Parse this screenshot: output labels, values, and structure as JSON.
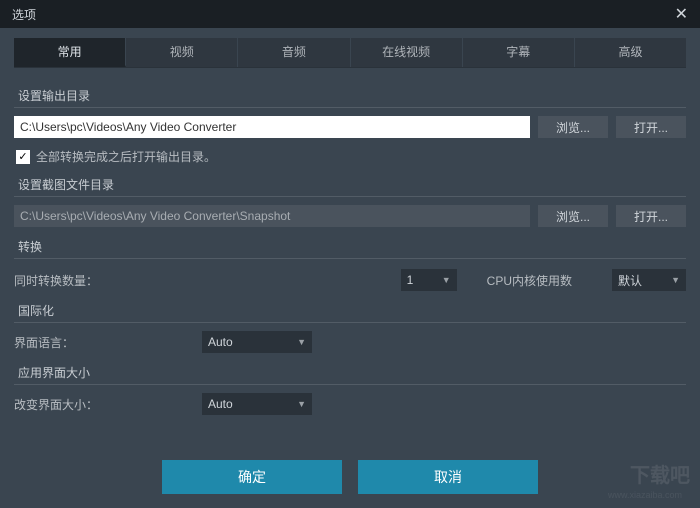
{
  "title": "选项",
  "tabs": [
    "常用",
    "视频",
    "音频",
    "在线视频",
    "字幕",
    "高级"
  ],
  "sections": {
    "output": {
      "header": "设置输出目录",
      "path": "C:\\Users\\pc\\Videos\\Any Video Converter",
      "browse": "浏览...",
      "open": "打开...",
      "checkbox_label": "全部转换完成之后打开输出目录。"
    },
    "snapshot": {
      "header": "设置截图文件目录",
      "path": "C:\\Users\\pc\\Videos\\Any Video Converter\\Snapshot",
      "browse": "浏览...",
      "open": "打开..."
    },
    "convert": {
      "header": "转换",
      "count_label": "同时转换数量：",
      "count_value": "1",
      "cpu_label": "CPU内核使用数",
      "cpu_value": "默认"
    },
    "intl": {
      "header": "国际化",
      "lang_label": "界面语言：",
      "lang_value": "Auto"
    },
    "uisize": {
      "header": "应用界面大小",
      "size_label": "改变界面大小：",
      "size_value": "Auto"
    }
  },
  "footer": {
    "ok": "确定",
    "cancel": "取消"
  },
  "watermark": "下载吧",
  "watermark_url": "www.xiazaiba.com"
}
